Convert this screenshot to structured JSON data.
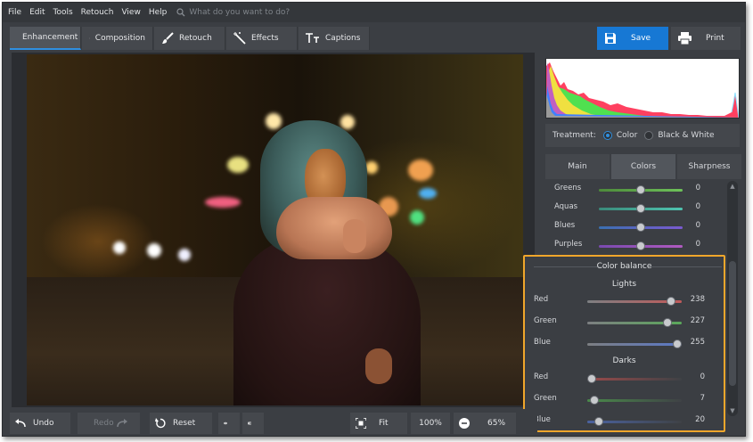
{
  "menu": {
    "items": [
      "File",
      "Edit",
      "Tools",
      "Retouch",
      "View",
      "Help"
    ],
    "search_placeholder": "What do you want to do?"
  },
  "toolbar": {
    "tabs": [
      {
        "label": "Enhancement",
        "icon": "sliders-icon",
        "active": true
      },
      {
        "label": "Composition",
        "icon": "crop-icon"
      },
      {
        "label": "Retouch",
        "icon": "brush-icon"
      },
      {
        "label": "Effects",
        "icon": "magic-wand-icon"
      },
      {
        "label": "Captions",
        "icon": "text-icon"
      }
    ],
    "save_label": "Save",
    "print_label": "Print"
  },
  "panel": {
    "treatment_label": "Treatment:",
    "treatment_options": [
      "Color",
      "Black & White"
    ],
    "treatment_selected": "Color",
    "subtabs": [
      "Main",
      "Colors",
      "Sharpness"
    ],
    "subtab_active": "Colors",
    "hue_sliders": [
      {
        "name": "Greens",
        "value": "0",
        "fraction": 0.5,
        "color_left": "#4d8a3a",
        "color_right": "#6ec25a"
      },
      {
        "name": "Aquas",
        "value": "0",
        "fraction": 0.5,
        "color_left": "#3a8a7a",
        "color_right": "#4fc4b0"
      },
      {
        "name": "Blues",
        "value": "0",
        "fraction": 0.5,
        "color_left": "#3a6fb0",
        "color_right": "#7a5ad0"
      },
      {
        "name": "Purples",
        "value": "0",
        "fraction": 0.5,
        "color_left": "#7a4ab0",
        "color_right": "#b05ac0"
      }
    ],
    "color_balance": {
      "title": "Color balance",
      "lights_label": "Lights",
      "darks_label": "Darks",
      "lights": [
        {
          "name": "Red",
          "value": "238",
          "fraction": 0.93,
          "color": "#c05a5a"
        },
        {
          "name": "Green",
          "value": "227",
          "fraction": 0.89,
          "color": "#5aa85a"
        },
        {
          "name": "Blue",
          "value": "255",
          "fraction": 1.0,
          "color": "#5a78c8"
        }
      ],
      "darks": [
        {
          "name": "Red",
          "value": "0",
          "fraction": 0.0,
          "color": "#9a4a4a"
        },
        {
          "name": "Green",
          "value": "7",
          "fraction": 0.03,
          "color": "#4a8a4a"
        },
        {
          "name": "Blue",
          "value": "20",
          "fraction": 0.08,
          "color": "#4a62a0"
        }
      ]
    }
  },
  "bottombar": {
    "undo_label": "Undo",
    "redo_label": "Redo",
    "reset_label": "Reset",
    "fit_label": "Fit",
    "zoom_100_label": "100%",
    "zoom_value": "65%"
  },
  "colors": {
    "accent": "#1778d4",
    "highlight_border": "#f0a62b"
  }
}
